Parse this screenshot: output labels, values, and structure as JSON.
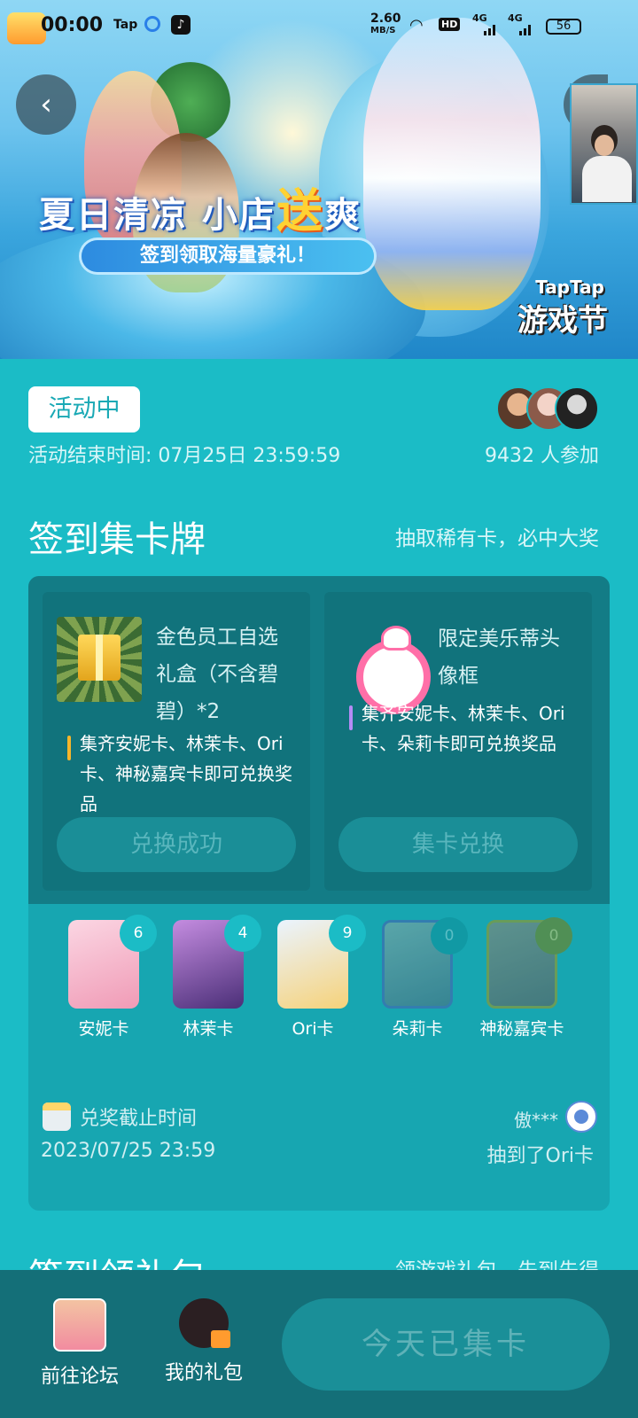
{
  "status_bar": {
    "time": "00:00",
    "tap_label": "Tap",
    "net_speed": "2.60",
    "net_unit": "MB/S",
    "hd": "HD",
    "signal1": "4G",
    "signal2": "4G",
    "battery": "56"
  },
  "hero": {
    "title_part1": "夏日清凉 小店",
    "title_highlight": "送",
    "title_part2": "爽",
    "subtitle": "签到领取海量豪礼！",
    "fest_brand": "TapTap",
    "fest_name": "游戏节"
  },
  "activity": {
    "status": "活动中",
    "end_time": "活动结束时间: 07月25日 23:59:59",
    "participants": "9432 人参加"
  },
  "section1": {
    "title": "签到集卡牌",
    "hint": "抽取稀有卡，必中大奖"
  },
  "rewards": [
    {
      "name": "金色员工自选礼盒（不含碧碧）*2",
      "desc": "集齐安妮卡、林茉卡、Ori卡、神秘嘉宾卡即可兑换奖品",
      "button": "兑换成功"
    },
    {
      "name": "限定美乐蒂头像框",
      "desc": "集齐安妮卡、林茉卡、Ori卡、朵莉卡即可兑换奖品",
      "button": "集卡兑换"
    }
  ],
  "cards": [
    {
      "name": "安妮卡",
      "count": "6",
      "color": "#f3b6c7"
    },
    {
      "name": "林茉卡",
      "count": "4",
      "color": "#8b5fb8"
    },
    {
      "name": "Ori卡",
      "count": "9",
      "color": "#cfe3f7"
    },
    {
      "name": "朵莉卡",
      "count": "0",
      "color": "#4f8ea0"
    },
    {
      "name": "神秘嘉宾卡",
      "count": "0",
      "color": "#5f8a8f"
    }
  ],
  "deadline": {
    "label": "兑奖截止时间",
    "value": "2023/07/25 23:59"
  },
  "winner": {
    "name": "傲***",
    "text": "抽到了Ori卡"
  },
  "section2": {
    "title": "签到领礼包",
    "hint": "领游戏礼包，先到先得"
  },
  "bottom": {
    "forum": "前往论坛",
    "my_gift": "我的礼包",
    "today": "今天已集卡"
  }
}
